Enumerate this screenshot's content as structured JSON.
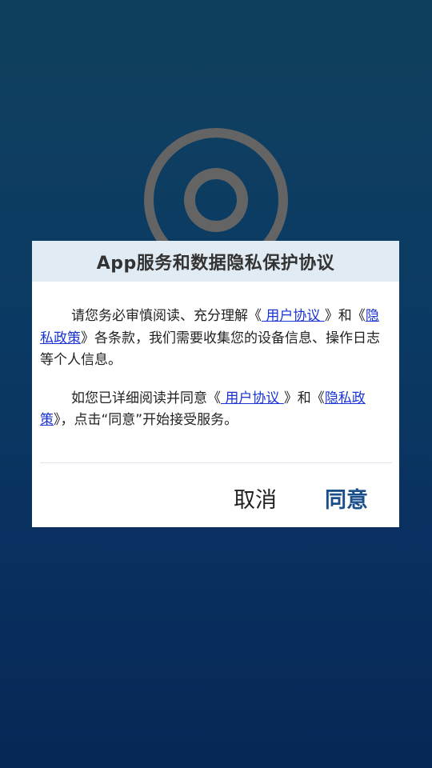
{
  "dialog": {
    "title": "App服务和数据隐私保护协议",
    "paragraph1": {
      "part1": "请您务必审慎阅读、充分理解《",
      "link1": " 用户协议 ",
      "part2": "》和《",
      "link2": "隐私政策",
      "part3": "》各条款，我们需要收集您的设备信息、操作日志等个人信息。"
    },
    "paragraph2": {
      "part1": "如您已详细阅读并同意《",
      "link1": " 用户协议 ",
      "part2": "》和《",
      "link2": "隐私政策",
      "part3": "》，点击“同意”开始接受服务。"
    },
    "cancel_label": "取消",
    "agree_label": "同意"
  },
  "colors": {
    "background_top": "#124566",
    "background_bottom": "#082a5c",
    "header_bg": "#e1ebf3",
    "link": "#1a33d6",
    "agree": "#1b4f8c"
  },
  "icons": {
    "background_logo": "camera-lens-logo-icon"
  }
}
